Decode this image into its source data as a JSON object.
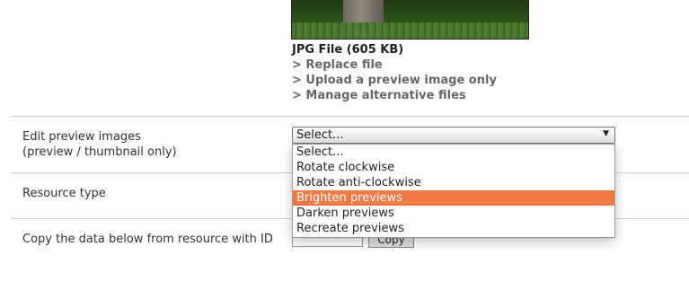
{
  "file": {
    "title": "JPG File (605 KB)",
    "links": [
      "> Replace file",
      "> Upload a preview image only",
      "> Manage alternative files"
    ]
  },
  "edit_preview": {
    "label_line1": "Edit preview images",
    "label_line2": "(preview / thumbnail only)",
    "selected": "Select...",
    "options": [
      "Select...",
      "Rotate clockwise",
      "Rotate anti-clockwise",
      "Brighten previews",
      "Darken previews",
      "Recreate previews"
    ],
    "highlighted_option": "Brighten previews"
  },
  "resource_type": {
    "label": "Resource type"
  },
  "copy_data": {
    "label": "Copy the data below from resource with ID",
    "button": "Copy"
  },
  "colors": {
    "highlight": "#f07843",
    "link": "#666666"
  }
}
